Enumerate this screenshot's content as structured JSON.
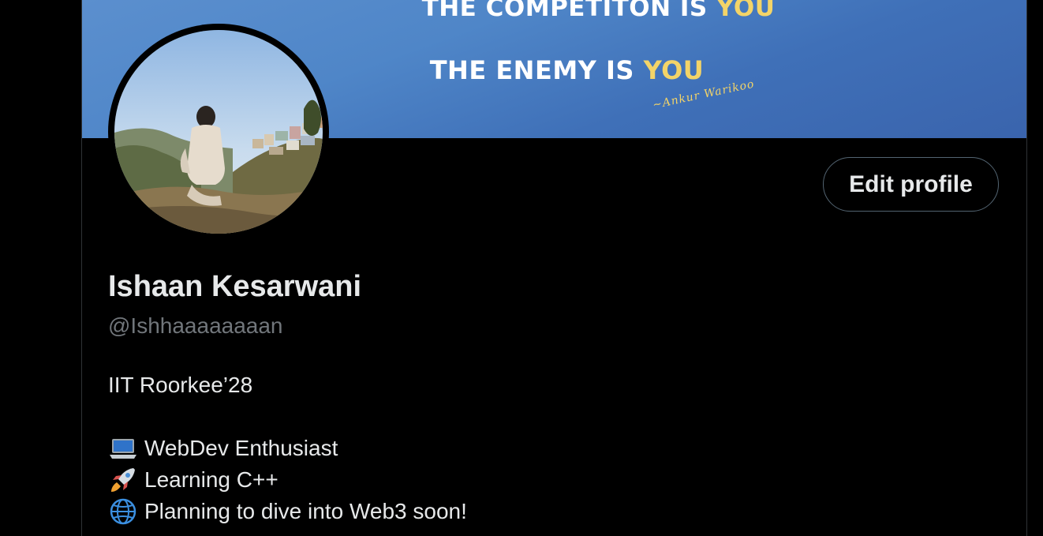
{
  "banner": {
    "line1_prefix": "THE COMPETITON IS ",
    "line1_highlight": "YOU",
    "line2_prefix": "THE ENEMY IS ",
    "line2_highlight": "YOU",
    "signature": "~Ankur Warikoo"
  },
  "profile": {
    "name": "Ishaan Kesarwani",
    "handle": "@Ishhaaaaaaaan",
    "edit_label": "Edit profile"
  },
  "bio": {
    "line1": "IIT Roorkee’28",
    "items": [
      {
        "icon": "laptop-icon",
        "text": "WebDev Enthusiast"
      },
      {
        "icon": "rocket-icon",
        "text": "Learning C++"
      },
      {
        "icon": "globe-icon",
        "text": "Planning to dive into Web3 soon!"
      }
    ]
  },
  "colors": {
    "background": "#000000",
    "banner_blue": "#4f86c8",
    "highlight_yellow": "#f3d468",
    "text_primary": "#e7e9ea",
    "text_secondary": "#71767b"
  }
}
